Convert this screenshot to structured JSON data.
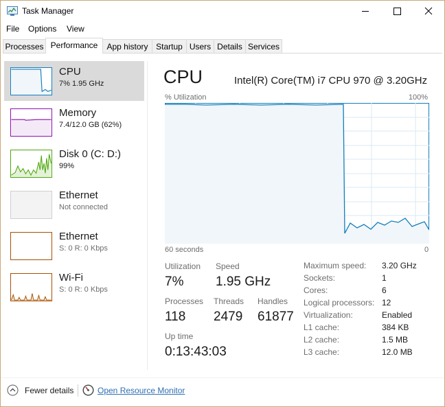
{
  "window": {
    "title": "Task Manager",
    "icon": "task-manager-icon"
  },
  "menu": [
    "File",
    "Options",
    "View"
  ],
  "tabs": [
    "Processes",
    "Performance",
    "App history",
    "Startup",
    "Users",
    "Details",
    "Services"
  ],
  "active_tab": "Performance",
  "sidebar": [
    {
      "title": "CPU",
      "sub": "7%  1.95 GHz",
      "color": "#117dbb"
    },
    {
      "title": "Memory",
      "sub": "7.4/12.0 GB (62%)",
      "color": "#8b12ae"
    },
    {
      "title": "Disk 0 (C: D:)",
      "sub": "99%",
      "color": "#4da60c"
    },
    {
      "title": "Ethernet",
      "sub": "Not connected",
      "color": "#a0a0a0"
    },
    {
      "title": "Ethernet",
      "sub": "S: 0 R: 0 Kbps",
      "color": "#a74f01"
    },
    {
      "title": "Wi-Fi",
      "sub": "S: 0 R: 0 Kbps",
      "color": "#a74f01"
    }
  ],
  "main": {
    "title": "CPU",
    "model": "Intel(R) Core(TM) i7 CPU 970 @ 3.20GHz",
    "util_label": "% Utilization",
    "max_label": "100%",
    "axis_left": "60 seconds",
    "axis_right": "0",
    "accent": "#117dbb",
    "stats": {
      "utilization": {
        "label": "Utilization",
        "value": "7%"
      },
      "speed": {
        "label": "Speed",
        "value": "1.95 GHz"
      },
      "processes": {
        "label": "Processes",
        "value": "118"
      },
      "threads": {
        "label": "Threads",
        "value": "2479"
      },
      "handles": {
        "label": "Handles",
        "value": "61877"
      },
      "uptime": {
        "label": "Up time",
        "value": "0:13:43:03"
      }
    },
    "specs": [
      {
        "label": "Maximum speed:",
        "value": "3.20 GHz"
      },
      {
        "label": "Sockets:",
        "value": "1"
      },
      {
        "label": "Cores:",
        "value": "6"
      },
      {
        "label": "Logical processors:",
        "value": "12"
      },
      {
        "label": "Virtualization:",
        "value": "Enabled"
      },
      {
        "label": "L1 cache:",
        "value": "384 KB"
      },
      {
        "label": "L2 cache:",
        "value": "1.5 MB"
      },
      {
        "label": "L3 cache:",
        "value": "12.0 MB"
      }
    ]
  },
  "footer": {
    "fewer_details": "Fewer details",
    "open_monitor": "Open Resource Monitor"
  }
}
